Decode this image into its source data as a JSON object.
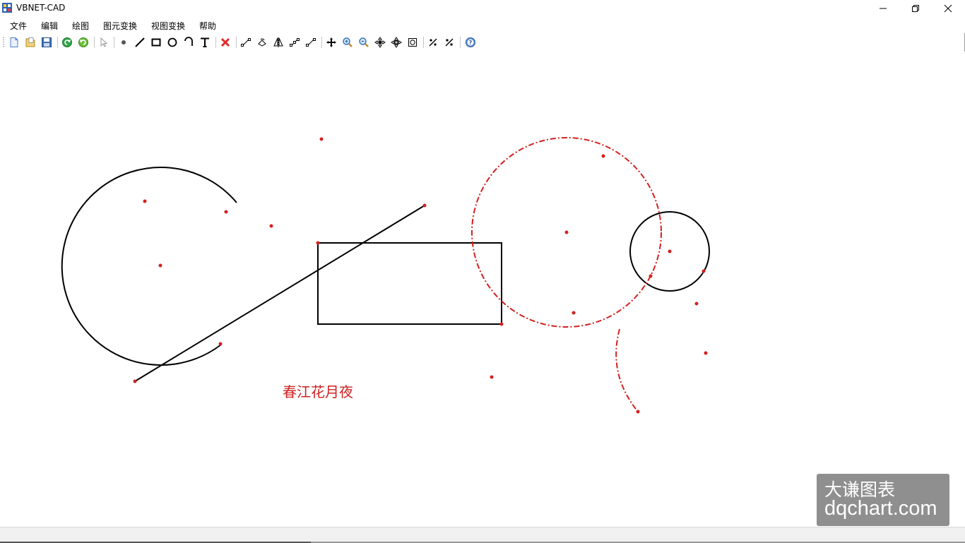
{
  "window": {
    "title": "VBNET-CAD",
    "controls": [
      "minimize",
      "restore",
      "close"
    ]
  },
  "menu": {
    "items": [
      "文件",
      "编辑",
      "绘图",
      "图元变换",
      "视图变换",
      "帮助"
    ]
  },
  "toolbar": {
    "buttons": [
      {
        "name": "new-file",
        "icon": "new-document-icon"
      },
      {
        "name": "open-file",
        "icon": "open-folder-icon"
      },
      {
        "name": "save-file",
        "icon": "save-disk-icon"
      },
      {
        "name": "undo",
        "icon": "undo-arrow-icon"
      },
      {
        "name": "redo",
        "icon": "redo-arrow-icon"
      },
      {
        "name": "select",
        "icon": "cursor-arrow-icon"
      },
      {
        "name": "draw-point",
        "icon": "point-dot-icon"
      },
      {
        "name": "draw-line",
        "icon": "line-icon"
      },
      {
        "name": "draw-rectangle",
        "icon": "rectangle-icon"
      },
      {
        "name": "draw-circle",
        "icon": "circle-icon"
      },
      {
        "name": "draw-arc",
        "icon": "arc-icon"
      },
      {
        "name": "draw-text",
        "icon": "text-T-icon"
      },
      {
        "name": "delete",
        "icon": "red-x-icon"
      },
      {
        "name": "move-entity",
        "icon": "move-segment-icon"
      },
      {
        "name": "rotate-entity",
        "icon": "rotate-icon"
      },
      {
        "name": "mirror-entity",
        "icon": "mirror-icon"
      },
      {
        "name": "scale-entity",
        "icon": "scale-segment-icon"
      },
      {
        "name": "copy-entity",
        "icon": "copy-segment-icon"
      },
      {
        "name": "pan-view",
        "icon": "pan-cross-icon"
      },
      {
        "name": "zoom-in",
        "icon": "zoom-in-icon"
      },
      {
        "name": "zoom-out",
        "icon": "zoom-out-icon"
      },
      {
        "name": "zoom-window",
        "icon": "zoom-window-icon"
      },
      {
        "name": "zoom-realtime",
        "icon": "zoom-realtime-icon"
      },
      {
        "name": "zoom-extents",
        "icon": "zoom-extents-icon"
      },
      {
        "name": "snap-on",
        "icon": "snap-on-icon"
      },
      {
        "name": "snap-off",
        "icon": "snap-off-icon"
      },
      {
        "name": "help",
        "icon": "help-question-icon"
      }
    ]
  },
  "drawing": {
    "text_entity": "春江花月夜",
    "colors": {
      "entity": "#000000",
      "selected": "#d42020",
      "grip": "#d42020"
    }
  },
  "watermark": {
    "line1": "大谦图表",
    "line2": "dqchart.com"
  }
}
